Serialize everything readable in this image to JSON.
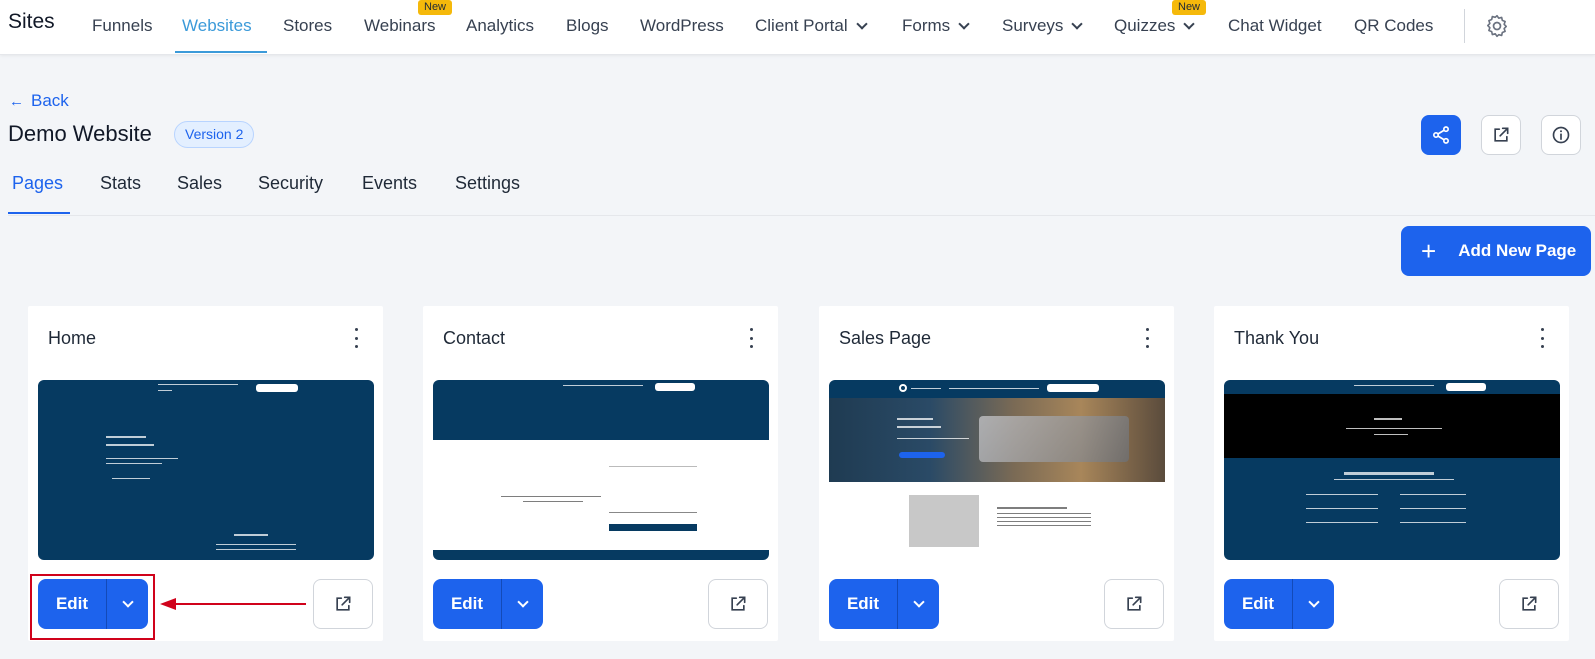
{
  "nav": {
    "brand": "Sites",
    "items": [
      {
        "label": "Funnels"
      },
      {
        "label": "Websites"
      },
      {
        "label": "Stores"
      },
      {
        "label": "Webinars"
      },
      {
        "label": "Analytics"
      },
      {
        "label": "Blogs"
      },
      {
        "label": "WordPress"
      },
      {
        "label": "Client Portal"
      },
      {
        "label": "Forms"
      },
      {
        "label": "Surveys"
      },
      {
        "label": "Quizzes"
      },
      {
        "label": "Chat Widget"
      },
      {
        "label": "QR Codes"
      }
    ],
    "active": "Websites",
    "new_badge": "New",
    "settings_icon": "gear-icon"
  },
  "header": {
    "back_label": "Back",
    "title": "Demo Website",
    "version": "Version 2",
    "share_icon": "share-icon",
    "open_icon": "external-link-icon",
    "info_icon": "info-icon"
  },
  "tabs": [
    "Pages",
    "Stats",
    "Sales",
    "Security",
    "Events",
    "Settings"
  ],
  "active_tab": "Pages",
  "add_page_label": "Add New Page",
  "pages": [
    {
      "name": "Home",
      "edit_label": "Edit"
    },
    {
      "name": "Contact",
      "edit_label": "Edit"
    },
    {
      "name": "Sales Page",
      "edit_label": "Edit"
    },
    {
      "name": "Thank You",
      "edit_label": "Edit"
    }
  ],
  "colors": {
    "primary": "#1d63ed",
    "nav_active": "#3b9ad9",
    "badge": "#f5b90b",
    "thumbnail_navy": "#063a61",
    "annotation": "#d0021b"
  }
}
